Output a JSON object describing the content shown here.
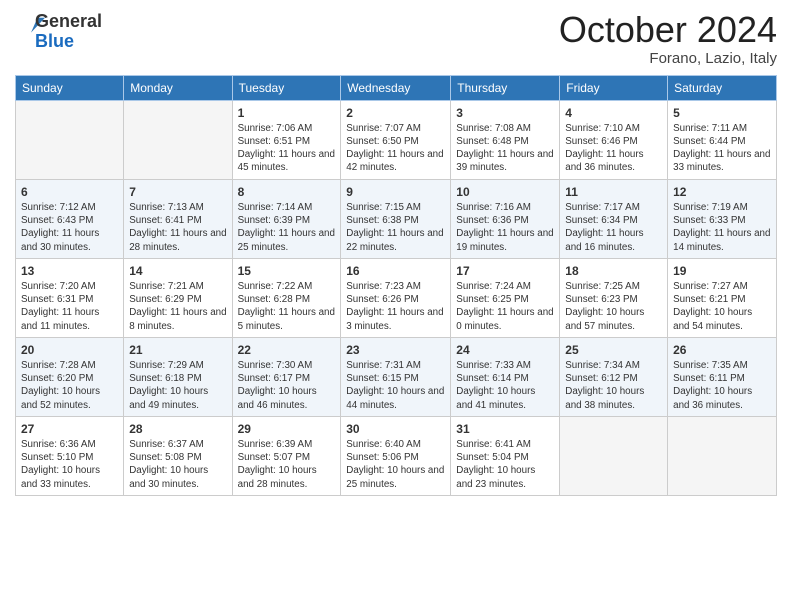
{
  "header": {
    "logo_line1": "General",
    "logo_line2": "Blue",
    "month": "October 2024",
    "location": "Forano, Lazio, Italy"
  },
  "weekdays": [
    "Sunday",
    "Monday",
    "Tuesday",
    "Wednesday",
    "Thursday",
    "Friday",
    "Saturday"
  ],
  "weeks": [
    [
      {
        "day": "",
        "info": ""
      },
      {
        "day": "",
        "info": ""
      },
      {
        "day": "1",
        "info": "Sunrise: 7:06 AM\nSunset: 6:51 PM\nDaylight: 11 hours and 45 minutes."
      },
      {
        "day": "2",
        "info": "Sunrise: 7:07 AM\nSunset: 6:50 PM\nDaylight: 11 hours and 42 minutes."
      },
      {
        "day": "3",
        "info": "Sunrise: 7:08 AM\nSunset: 6:48 PM\nDaylight: 11 hours and 39 minutes."
      },
      {
        "day": "4",
        "info": "Sunrise: 7:10 AM\nSunset: 6:46 PM\nDaylight: 11 hours and 36 minutes."
      },
      {
        "day": "5",
        "info": "Sunrise: 7:11 AM\nSunset: 6:44 PM\nDaylight: 11 hours and 33 minutes."
      }
    ],
    [
      {
        "day": "6",
        "info": "Sunrise: 7:12 AM\nSunset: 6:43 PM\nDaylight: 11 hours and 30 minutes."
      },
      {
        "day": "7",
        "info": "Sunrise: 7:13 AM\nSunset: 6:41 PM\nDaylight: 11 hours and 28 minutes."
      },
      {
        "day": "8",
        "info": "Sunrise: 7:14 AM\nSunset: 6:39 PM\nDaylight: 11 hours and 25 minutes."
      },
      {
        "day": "9",
        "info": "Sunrise: 7:15 AM\nSunset: 6:38 PM\nDaylight: 11 hours and 22 minutes."
      },
      {
        "day": "10",
        "info": "Sunrise: 7:16 AM\nSunset: 6:36 PM\nDaylight: 11 hours and 19 minutes."
      },
      {
        "day": "11",
        "info": "Sunrise: 7:17 AM\nSunset: 6:34 PM\nDaylight: 11 hours and 16 minutes."
      },
      {
        "day": "12",
        "info": "Sunrise: 7:19 AM\nSunset: 6:33 PM\nDaylight: 11 hours and 14 minutes."
      }
    ],
    [
      {
        "day": "13",
        "info": "Sunrise: 7:20 AM\nSunset: 6:31 PM\nDaylight: 11 hours and 11 minutes."
      },
      {
        "day": "14",
        "info": "Sunrise: 7:21 AM\nSunset: 6:29 PM\nDaylight: 11 hours and 8 minutes."
      },
      {
        "day": "15",
        "info": "Sunrise: 7:22 AM\nSunset: 6:28 PM\nDaylight: 11 hours and 5 minutes."
      },
      {
        "day": "16",
        "info": "Sunrise: 7:23 AM\nSunset: 6:26 PM\nDaylight: 11 hours and 3 minutes."
      },
      {
        "day": "17",
        "info": "Sunrise: 7:24 AM\nSunset: 6:25 PM\nDaylight: 11 hours and 0 minutes."
      },
      {
        "day": "18",
        "info": "Sunrise: 7:25 AM\nSunset: 6:23 PM\nDaylight: 10 hours and 57 minutes."
      },
      {
        "day": "19",
        "info": "Sunrise: 7:27 AM\nSunset: 6:21 PM\nDaylight: 10 hours and 54 minutes."
      }
    ],
    [
      {
        "day": "20",
        "info": "Sunrise: 7:28 AM\nSunset: 6:20 PM\nDaylight: 10 hours and 52 minutes."
      },
      {
        "day": "21",
        "info": "Sunrise: 7:29 AM\nSunset: 6:18 PM\nDaylight: 10 hours and 49 minutes."
      },
      {
        "day": "22",
        "info": "Sunrise: 7:30 AM\nSunset: 6:17 PM\nDaylight: 10 hours and 46 minutes."
      },
      {
        "day": "23",
        "info": "Sunrise: 7:31 AM\nSunset: 6:15 PM\nDaylight: 10 hours and 44 minutes."
      },
      {
        "day": "24",
        "info": "Sunrise: 7:33 AM\nSunset: 6:14 PM\nDaylight: 10 hours and 41 minutes."
      },
      {
        "day": "25",
        "info": "Sunrise: 7:34 AM\nSunset: 6:12 PM\nDaylight: 10 hours and 38 minutes."
      },
      {
        "day": "26",
        "info": "Sunrise: 7:35 AM\nSunset: 6:11 PM\nDaylight: 10 hours and 36 minutes."
      }
    ],
    [
      {
        "day": "27",
        "info": "Sunrise: 6:36 AM\nSunset: 5:10 PM\nDaylight: 10 hours and 33 minutes."
      },
      {
        "day": "28",
        "info": "Sunrise: 6:37 AM\nSunset: 5:08 PM\nDaylight: 10 hours and 30 minutes."
      },
      {
        "day": "29",
        "info": "Sunrise: 6:39 AM\nSunset: 5:07 PM\nDaylight: 10 hours and 28 minutes."
      },
      {
        "day": "30",
        "info": "Sunrise: 6:40 AM\nSunset: 5:06 PM\nDaylight: 10 hours and 25 minutes."
      },
      {
        "day": "31",
        "info": "Sunrise: 6:41 AM\nSunset: 5:04 PM\nDaylight: 10 hours and 23 minutes."
      },
      {
        "day": "",
        "info": ""
      },
      {
        "day": "",
        "info": ""
      }
    ]
  ]
}
